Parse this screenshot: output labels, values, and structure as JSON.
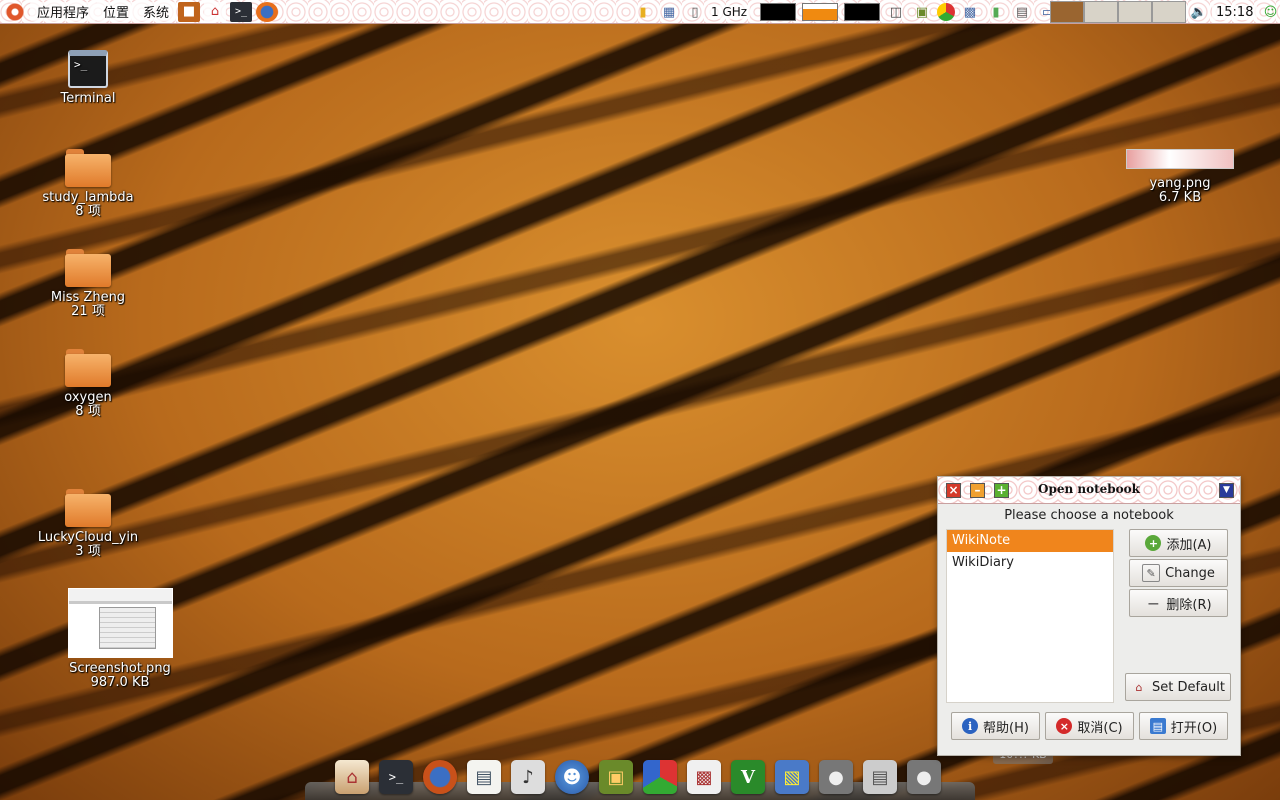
{
  "top_panel": {
    "menus": [
      "应用程序",
      "位置",
      "系统"
    ],
    "cpu_freq": "1 GHz",
    "clock": "15:18",
    "launcher_icons": [
      "app-store-icon",
      "home-icon",
      "terminal-icon",
      "firefox-icon"
    ],
    "tray_icons": [
      "folder-icon",
      "calendar-icon",
      "phone-icon",
      "volume-icon",
      "running-man-icon"
    ]
  },
  "desktop": {
    "icons": [
      {
        "name": "Terminal",
        "sub": ""
      },
      {
        "name": "study_lambda",
        "sub": "8 项"
      },
      {
        "name": "Miss Zheng",
        "sub": "21 项"
      },
      {
        "name": "oxygen",
        "sub": "8 项"
      },
      {
        "name": "LuckyCloud_yin",
        "sub": "3 项"
      },
      {
        "name": "Screenshot.png",
        "sub": "987.0 KB"
      },
      {
        "name": "yang.png",
        "sub": "6.7 KB"
      }
    ]
  },
  "dialog": {
    "title": "Open notebook",
    "prompt": "Please choose a notebook",
    "notebooks": [
      {
        "label": "WikiNote",
        "selected": true
      },
      {
        "label": "WikiDiary",
        "selected": false
      }
    ],
    "buttons": {
      "add": "添加(A)",
      "change": "Change",
      "remove": "删除(R)",
      "set_default": "Set Default",
      "help": "帮助(H)",
      "cancel": "取消(C)",
      "open": "打开(O)"
    },
    "accent": "#f0851c"
  },
  "dock": {
    "items": [
      "home-icon",
      "terminal-icon",
      "firefox-icon",
      "document-viewer-icon",
      "music-player-icon",
      "chat-icon",
      "book-icon",
      "cube-icon",
      "screenshot-icon",
      "vim-icon",
      "files-icon",
      "gimp-icon",
      "file-cabinet-icon",
      "gimp-icon-2"
    ],
    "tooltip": "10?.? KB"
  }
}
